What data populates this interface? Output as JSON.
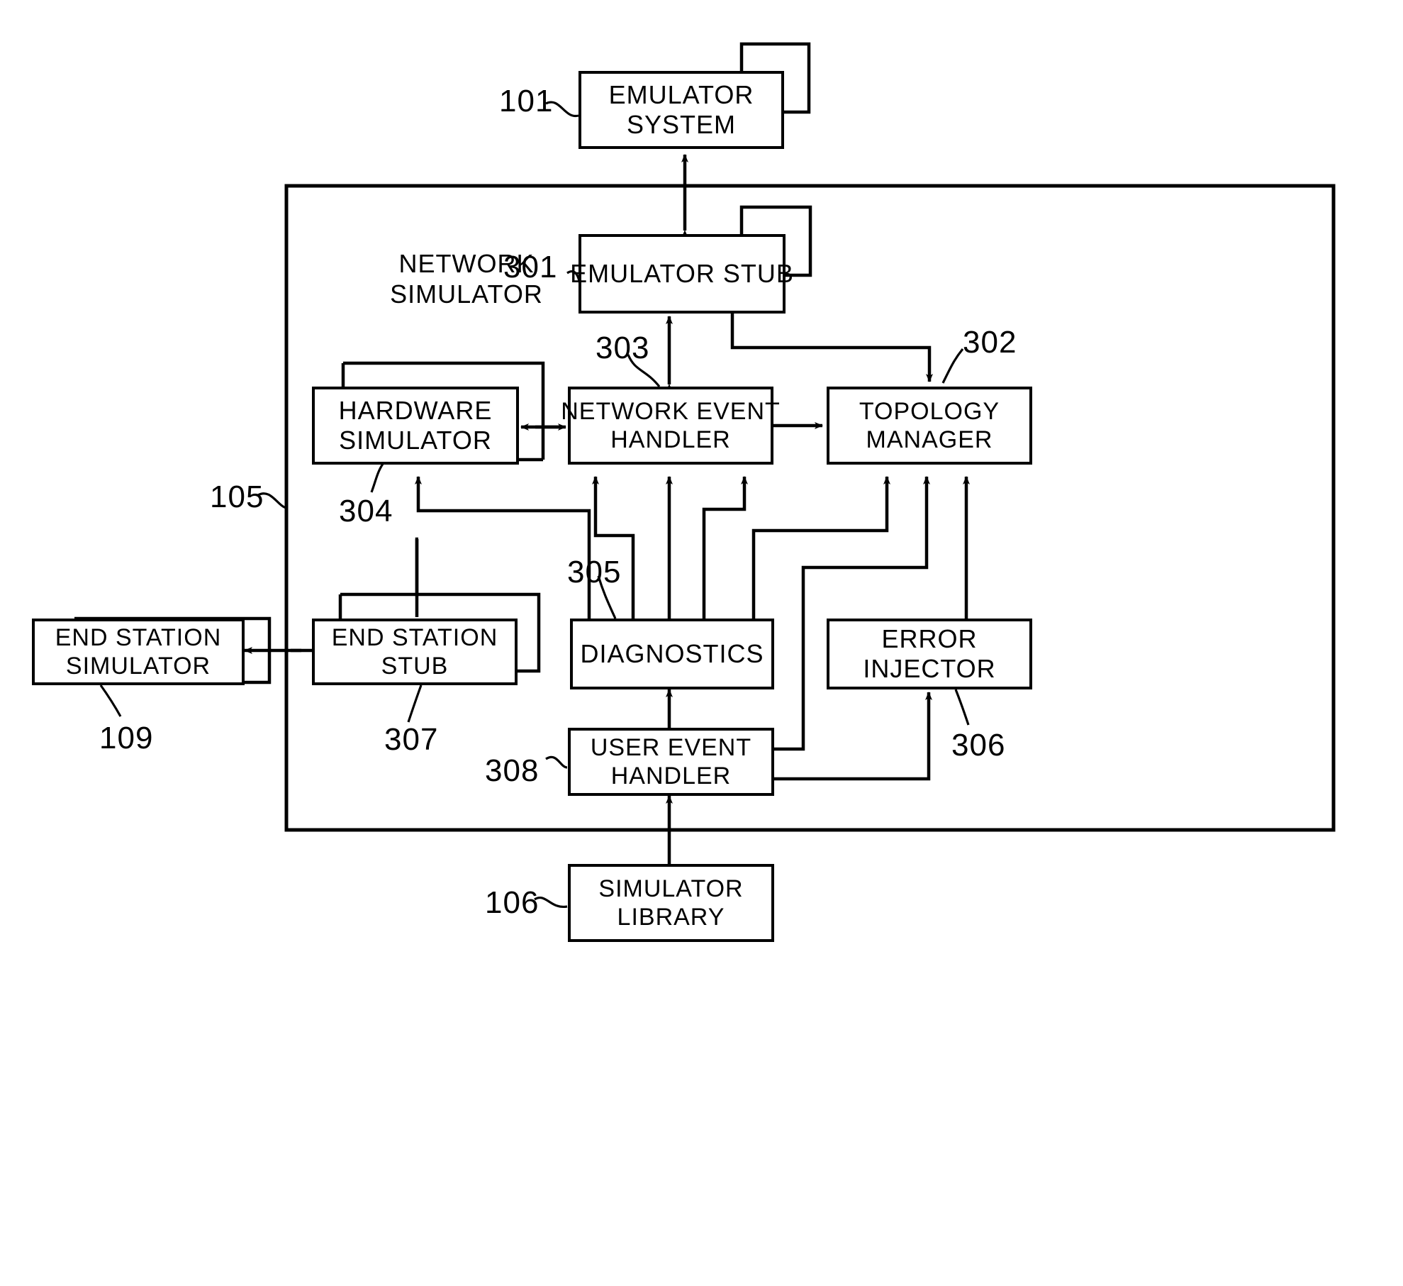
{
  "figure": {
    "kind": "patent-block-diagram",
    "stroke_color": "#000000",
    "background_color": "#ffffff"
  },
  "group_labels": [
    {
      "name": "network-simulator-group-label",
      "lines": [
        "NETWORK",
        "SIMULATOR"
      ]
    }
  ],
  "blocks": [
    {
      "id": "emulator-system",
      "lines": [
        "EMULATOR",
        "SYSTEM"
      ],
      "ref": "101"
    },
    {
      "id": "emulator-stub",
      "lines": [
        "EMULATOR  STUB"
      ],
      "ref": "301"
    },
    {
      "id": "hardware-simulator",
      "lines": [
        "HARDWARE",
        "SIMULATOR"
      ],
      "ref": "304"
    },
    {
      "id": "network-event-handler",
      "lines": [
        "NETWORK  EVENT",
        "HANDLER"
      ],
      "ref": "303"
    },
    {
      "id": "topology-manager",
      "lines": [
        "TOPOLOGY",
        "MANAGER"
      ],
      "ref": "302"
    },
    {
      "id": "end-station-simulator",
      "lines": [
        "END  STATION",
        "SIMULATOR"
      ],
      "ref": "109"
    },
    {
      "id": "end-station-stub",
      "lines": [
        "END  STATION",
        "STUB"
      ],
      "ref": "307"
    },
    {
      "id": "diagnostics",
      "lines": [
        "DIAGNOSTICS"
      ],
      "ref": "305"
    },
    {
      "id": "error-injector",
      "lines": [
        "ERROR",
        "INJECTOR"
      ],
      "ref": "306"
    },
    {
      "id": "user-event-handler",
      "lines": [
        "USER  EVENT",
        "HANDLER"
      ],
      "ref": "308"
    },
    {
      "id": "simulator-library",
      "lines": [
        "SIMULATOR",
        "LIBRARY"
      ],
      "ref": "106"
    }
  ],
  "reference_numerals": [
    {
      "name": "ref-101",
      "value": "101",
      "points_to": "emulator-system"
    },
    {
      "name": "ref-301",
      "value": "301",
      "points_to": "emulator-stub"
    },
    {
      "name": "ref-303",
      "value": "303",
      "points_to": "network-event-handler"
    },
    {
      "name": "ref-302",
      "value": "302",
      "points_to": "topology-manager"
    },
    {
      "name": "ref-304",
      "value": "304",
      "points_to": "hardware-simulator"
    },
    {
      "name": "ref-105",
      "value": "105",
      "points_to": "network-simulator-outer-box"
    },
    {
      "name": "ref-305",
      "value": "305",
      "points_to": "diagnostics"
    },
    {
      "name": "ref-109",
      "value": "109",
      "points_to": "end-station-simulator"
    },
    {
      "name": "ref-307",
      "value": "307",
      "points_to": "end-station-stub"
    },
    {
      "name": "ref-306",
      "value": "306",
      "points_to": "error-injector"
    },
    {
      "name": "ref-308",
      "value": "308",
      "points_to": "user-event-handler"
    },
    {
      "name": "ref-106",
      "value": "106",
      "points_to": "simulator-library"
    }
  ],
  "connections": [
    {
      "from": "emulator-stub",
      "to": "emulator-system",
      "type": "double-arrow"
    },
    {
      "from": "network-event-handler",
      "to": "emulator-stub",
      "type": "double-arrow"
    },
    {
      "from": "emulator-stub",
      "to": "topology-manager",
      "type": "arrow"
    },
    {
      "from": "hardware-simulator",
      "to": "network-event-handler",
      "type": "double-arrow"
    },
    {
      "from": "network-event-handler",
      "to": "topology-manager",
      "type": "arrow"
    },
    {
      "from": "end-station-simulator",
      "to": "end-station-stub",
      "type": "double-arrow"
    },
    {
      "from": "end-station-stub",
      "to": "hardware-simulator",
      "type": "arrow"
    },
    {
      "from": "diagnostics",
      "to": "hardware-simulator",
      "type": "arrow"
    },
    {
      "from": "diagnostics",
      "to": "network-event-handler",
      "type": "arrow"
    },
    {
      "from": "diagnostics",
      "to": "topology-manager",
      "type": "arrow"
    },
    {
      "from": "error-injector",
      "to": "network-event-handler",
      "type": "arrow"
    },
    {
      "from": "error-injector",
      "to": "topology-manager",
      "type": "arrow"
    },
    {
      "from": "user-event-handler",
      "to": "diagnostics",
      "type": "arrow"
    },
    {
      "from": "user-event-handler",
      "to": "topology-manager",
      "type": "arrow"
    },
    {
      "from": "user-event-handler",
      "to": "error-injector",
      "type": "arrow"
    },
    {
      "from": "simulator-library",
      "to": "user-event-handler",
      "type": "arrow"
    },
    {
      "from": "emulator-system",
      "to": "emulator-system",
      "type": "self-loop"
    },
    {
      "from": "emulator-stub",
      "to": "emulator-stub",
      "type": "self-loop"
    },
    {
      "from": "hardware-simulator",
      "to": "hardware-simulator",
      "type": "self-loop"
    },
    {
      "from": "end-station-simulator",
      "to": "end-station-simulator",
      "type": "self-loop"
    },
    {
      "from": "end-station-stub",
      "to": "end-station-stub",
      "type": "self-loop"
    }
  ]
}
